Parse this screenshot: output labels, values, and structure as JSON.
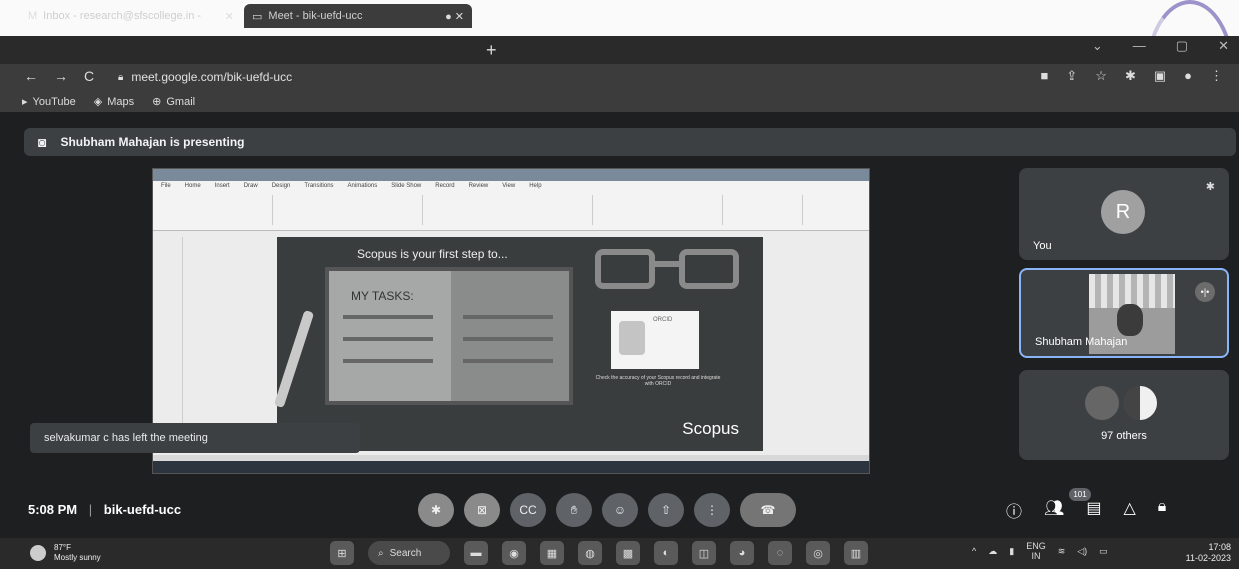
{
  "browser": {
    "tabs": [
      {
        "label": "Inbox - research@sfscollege.in -",
        "icon": "gmail-icon"
      },
      {
        "label": "Meet - bik-uefd-ucc",
        "icon": "meet-icon"
      }
    ],
    "url": "meet.google.com/bik-uefd-ucc",
    "bookmarks": [
      "YouTube",
      "Maps",
      "Gmail"
    ]
  },
  "meet": {
    "presenting_banner": "Shubham Mahajan is presenting",
    "toast": "selvakumar c has left the meeting",
    "time": "5:08 PM",
    "separator": "|",
    "meeting_code": "bik-uefd-ucc",
    "participants_badge": "101",
    "tiles": {
      "you_initial": "R",
      "you_label": "You",
      "presenter_label": "Shubham Mahajan",
      "others_label": "97 others"
    }
  },
  "shared_screen": {
    "slide_title": "Scopus is your first step to...",
    "tasks_heading": "MY TASKS:",
    "orcid_label": "ORCID",
    "caption": "Check the accuracy of your Scopus record and integrate with ORCID",
    "brand": "Scopus",
    "ribbon_tabs": [
      "File",
      "Home",
      "Insert",
      "Draw",
      "Design",
      "Transitions",
      "Animations",
      "Slide Show",
      "Record",
      "Review",
      "View",
      "Help"
    ]
  },
  "taskbar": {
    "weather_temp": "87°F",
    "weather_desc": "Mostly sunny",
    "search_label": "Search",
    "lang_top": "ENG",
    "lang_bottom": "IN",
    "clock_time": "17:08",
    "clock_date": "11-02-2023"
  }
}
